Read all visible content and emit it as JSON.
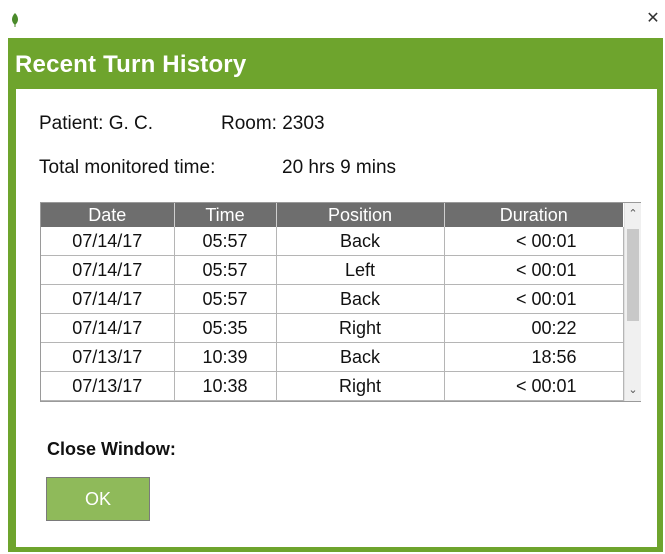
{
  "window": {
    "title": "Recent Turn History",
    "close_glyph": "✕",
    "icon": "leaf-icon",
    "accent_color": "#6ea42d"
  },
  "patient": {
    "name_label": "Patient: G. C.",
    "room_label": "Room: 2303",
    "monitored_label": "Total monitored time:",
    "monitored_value": "20 hrs 9 mins"
  },
  "table": {
    "headers": [
      "Date",
      "Time",
      "Position",
      "Duration"
    ],
    "rows": [
      [
        "07/14/17",
        "05:57",
        "Back",
        "< 00:01"
      ],
      [
        "07/14/17",
        "05:57",
        "Left",
        "< 00:01"
      ],
      [
        "07/14/17",
        "05:57",
        "Back",
        "< 00:01"
      ],
      [
        "07/14/17",
        "05:35",
        "Right",
        "00:22"
      ],
      [
        "07/13/17",
        "10:39",
        "Back",
        "18:56"
      ],
      [
        "07/13/17",
        "10:38",
        "Right",
        "< 00:01"
      ]
    ],
    "scroll_up_glyph": "⌃",
    "scroll_down_glyph": "⌄"
  },
  "footer": {
    "close_label": "Close Window:",
    "ok_label": "OK"
  }
}
